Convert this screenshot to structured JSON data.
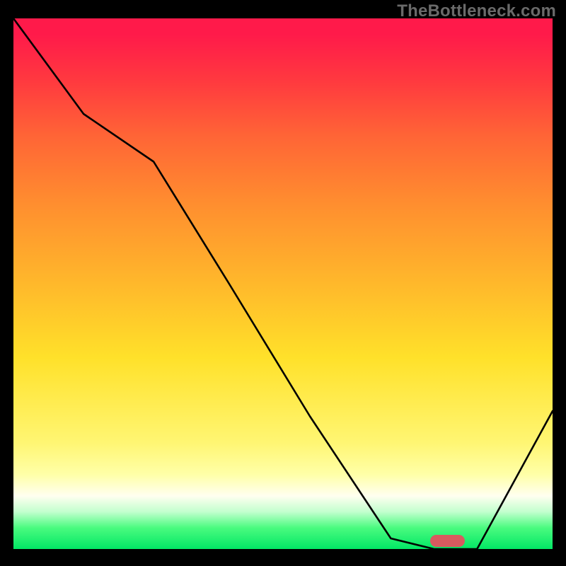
{
  "watermark": "TheBottleneck.com",
  "chart_data": {
    "type": "line",
    "title": "",
    "xlabel": "",
    "ylabel": "",
    "x": [
      0.0,
      0.13,
      0.26,
      0.4,
      0.55,
      0.7,
      0.78,
      0.86,
      1.0
    ],
    "values": [
      1.0,
      0.82,
      0.73,
      0.5,
      0.25,
      0.02,
      0.0,
      0.0,
      0.26
    ],
    "xlim": [
      0,
      1
    ],
    "ylim": [
      0,
      1
    ],
    "optimum_x": 0.805,
    "background_gradient": {
      "top": "#ff1a4a",
      "mid1": "#ffb82b",
      "mid2": "#fff673",
      "bottom": "#02e765"
    },
    "marker_color": "#d85a5f"
  }
}
